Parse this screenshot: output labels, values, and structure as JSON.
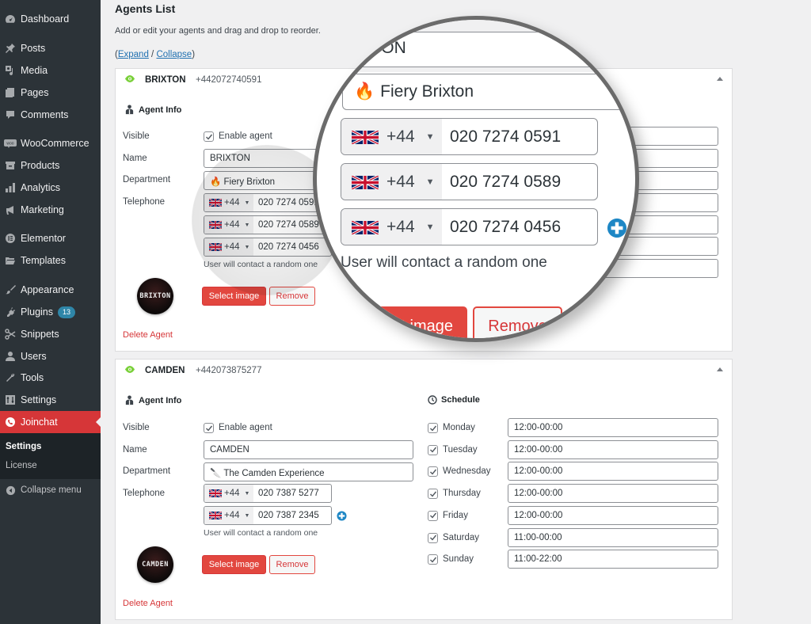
{
  "sidebar": {
    "items": [
      {
        "label": "Dashboard",
        "icon": "dashboard-icon"
      },
      {
        "label": "Posts",
        "icon": "pin-icon"
      },
      {
        "label": "Media",
        "icon": "media-icon"
      },
      {
        "label": "Pages",
        "icon": "pages-icon"
      },
      {
        "label": "Comments",
        "icon": "comment-icon"
      },
      {
        "label": "WooCommerce",
        "icon": "woocommerce-icon"
      },
      {
        "label": "Products",
        "icon": "archive-icon"
      },
      {
        "label": "Analytics",
        "icon": "bar-chart-icon"
      },
      {
        "label": "Marketing",
        "icon": "megaphone-icon"
      },
      {
        "label": "Elementor",
        "icon": "elementor-icon"
      },
      {
        "label": "Templates",
        "icon": "folder-icon"
      },
      {
        "label": "Appearance",
        "icon": "paintbrush-icon"
      },
      {
        "label": "Plugins",
        "icon": "plug-icon",
        "badge": "13"
      },
      {
        "label": "Snippets",
        "icon": "scissors-icon"
      },
      {
        "label": "Users",
        "icon": "user-icon"
      },
      {
        "label": "Tools",
        "icon": "wrench-icon"
      },
      {
        "label": "Settings",
        "icon": "settings-icon"
      },
      {
        "label": "Joinchat",
        "icon": "whatsapp-icon",
        "active": true
      }
    ],
    "submenu": [
      {
        "label": "Settings",
        "current": true
      },
      {
        "label": "License"
      }
    ],
    "collapse_label": "Collapse menu"
  },
  "page": {
    "title": "Agents List",
    "description": "Add or edit your agents and drag and drop to reorder.",
    "expand_label": "Expand",
    "collapse_label": "Collapse",
    "expand_open": "(",
    "expand_sep": " / ",
    "expand_close": ")"
  },
  "labels": {
    "agent_info": "Agent Info",
    "schedule": "Schedule",
    "visible": "Visible",
    "enable_agent": "Enable agent",
    "name": "Name",
    "department": "Department",
    "telephone": "Telephone",
    "random_hint": "User will contact a random one",
    "select_image": "Select image",
    "remove": "Remove",
    "delete_agent": "Delete Agent",
    "country_code": "+44"
  },
  "agents": [
    {
      "name": "BRIXTON",
      "header_phone": "+442072740591",
      "visible": true,
      "department": "Fiery Brixton",
      "department_emoji": "🔥",
      "phones": [
        "020 7274 0591",
        "020 7274 0589",
        "020 7274 0456"
      ],
      "avatar_text": "BRIXTON"
    },
    {
      "name": "CAMDEN",
      "header_phone": "+442073875277",
      "visible": true,
      "department": "The Camden Experience",
      "department_emoji": "🔪",
      "phones": [
        "020 7387 5277",
        "020 7387 2345"
      ],
      "avatar_text": "CAMDEN",
      "schedule": [
        {
          "day": "Monday",
          "enabled": true,
          "hours": "12:00-00:00"
        },
        {
          "day": "Tuesday",
          "enabled": true,
          "hours": "12:00-00:00"
        },
        {
          "day": "Wednesday",
          "enabled": true,
          "hours": "12:00-00:00"
        },
        {
          "day": "Thursday",
          "enabled": true,
          "hours": "12:00-00:00"
        },
        {
          "day": "Friday",
          "enabled": true,
          "hours": "12:00-00:00"
        },
        {
          "day": "Saturday",
          "enabled": true,
          "hours": "11:00-00:00"
        },
        {
          "day": "Sunday",
          "enabled": true,
          "hours": "11:00-22:00"
        }
      ]
    }
  ],
  "magnifier": {
    "name_fragment": "IXTON"
  },
  "colors": {
    "accent_red": "#e2473f",
    "link_blue": "#2271b1",
    "visible_green": "#7ad03a",
    "plus_blue": "#1e87c5"
  }
}
